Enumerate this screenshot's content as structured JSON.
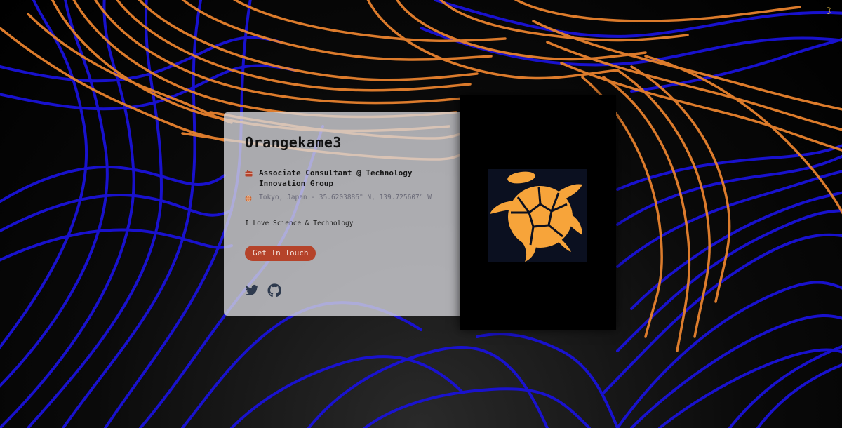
{
  "header": {
    "theme_toggle_icon": "moon-icon",
    "theme_toggle_glyph": "☽"
  },
  "profile": {
    "name": "Orangekame3",
    "job_icon": "briefcase-icon",
    "job": "Associate Consultant @ Technology Innovation Group",
    "location_icon": "globe-icon",
    "location": "Tokyo, Japan - 35.6203886° N, 139.725607° W",
    "bio": "I Love Science & Technology",
    "cta_label": "Get In Touch",
    "socials": [
      {
        "icon": "twitter-icon"
      },
      {
        "icon": "github-icon"
      }
    ],
    "avatar_icon": "turtle-icon"
  },
  "colors": {
    "accent": "#b5432a",
    "turtle": "#f7a43a",
    "orange_strands": "#e8822e",
    "blue_strands": "#1a12d8"
  }
}
